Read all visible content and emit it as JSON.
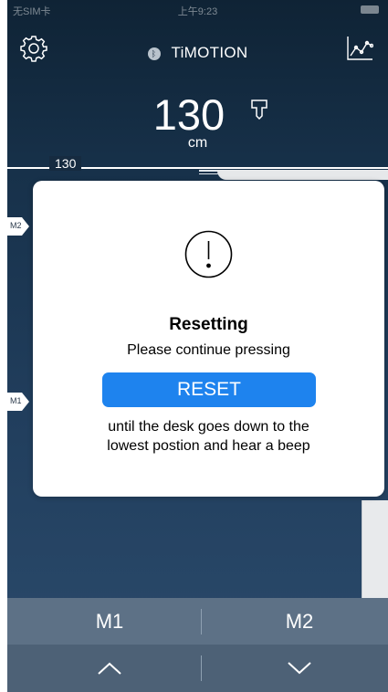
{
  "status_bar": {
    "carrier": "无SIM卡",
    "time": "上午9:23"
  },
  "header": {
    "brand": "TiMOTION",
    "height_value": "130",
    "height_unit": "cm"
  },
  "desk": {
    "height_label": "130",
    "markers": [
      "M2",
      "M1"
    ]
  },
  "dialog": {
    "title": "Resetting",
    "message_top": "Please continue pressing",
    "button_label": "RESET",
    "message_bottom_line1": "until the desk goes down to the",
    "message_bottom_line2": "lowest postion and hear a beep"
  },
  "memory_bar": {
    "m1_label": "M1",
    "m2_label": "M2"
  },
  "controls": {
    "up_icon": "chevron-up-icon",
    "down_icon": "chevron-down-icon"
  },
  "colors": {
    "background_top": "#0f2335",
    "background_bottom": "#2b4b6c",
    "reset_button": "#1e83ee",
    "bar_memory": "#5d7186",
    "bar_controls": "#4d6176"
  }
}
